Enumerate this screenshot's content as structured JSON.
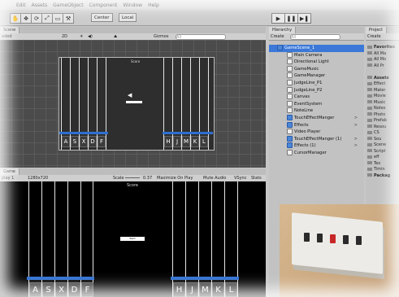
{
  "menu": [
    "Edit",
    "Assets",
    "GameObject",
    "Component",
    "Window",
    "Help"
  ],
  "toolbar": {
    "tools": [
      "✋",
      "✥",
      "⟳",
      "⤢",
      "▭",
      "⚒"
    ],
    "pivot_label": "Center",
    "local_label": "Local",
    "play": [
      "▶",
      "❚❚",
      "▶❚"
    ]
  },
  "scene": {
    "tab": "Scene",
    "shading": "aded",
    "twod": "2D",
    "gizmos": "Gizmos",
    "search_placeholder": "All",
    "overlay_score": "Score",
    "left_keys": [
      "A",
      "S",
      "X",
      "D",
      "F"
    ],
    "right_keys": [
      "H",
      "J",
      "M",
      "K",
      "L"
    ]
  },
  "game": {
    "tab": "Game",
    "display": "play 1",
    "resolution": "1280x720",
    "scale_label": "Scale",
    "scale_value": "0.37",
    "maximize": "Maximize On Play",
    "mute": "Mute Audio",
    "vsync": "VSync",
    "stats": "Stats",
    "score": "Score",
    "center_box": "Start",
    "left_keys": [
      "A",
      "S",
      "X",
      "D",
      "F"
    ],
    "right_keys": [
      "H",
      "J",
      "M",
      "K",
      "L"
    ]
  },
  "hierarchy": {
    "tab": "Hierarchy",
    "create": "Create",
    "search_placeholder": "All",
    "items": [
      {
        "label": "GameScene_1",
        "sel": true,
        "indent": 0,
        "icon": "blue",
        "arrow": ""
      },
      {
        "label": "Main Camera",
        "indent": 1,
        "icon": "",
        "arrow": ""
      },
      {
        "label": "Directional Light",
        "indent": 1,
        "icon": "",
        "arrow": ""
      },
      {
        "label": "GameMusic",
        "indent": 1,
        "icon": "",
        "arrow": ""
      },
      {
        "label": "GameManager",
        "indent": 1,
        "icon": "",
        "arrow": ""
      },
      {
        "label": "JudgeLine_P1",
        "indent": 1,
        "icon": "",
        "arrow": ""
      },
      {
        "label": "JudgeLine_P2",
        "indent": 1,
        "icon": "",
        "arrow": ""
      },
      {
        "label": "Canvas",
        "indent": 1,
        "icon": "",
        "arrow": ""
      },
      {
        "label": "EventSystem",
        "indent": 1,
        "icon": "",
        "arrow": ""
      },
      {
        "label": "NoteLine",
        "indent": 1,
        "icon": "",
        "arrow": ""
      },
      {
        "label": "TouchEffectManger",
        "indent": 1,
        "icon": "blue",
        "arrow": ">"
      },
      {
        "label": "Effects",
        "indent": 1,
        "icon": "blue",
        "arrow": ">"
      },
      {
        "label": "Video Player",
        "indent": 1,
        "icon": "",
        "arrow": ""
      },
      {
        "label": "TouchEffectManger (1)",
        "indent": 1,
        "icon": "blue",
        "arrow": ">"
      },
      {
        "label": "Effects (1)",
        "indent": 1,
        "icon": "blue",
        "arrow": ">"
      },
      {
        "label": "CursorManager",
        "indent": 1,
        "icon": "",
        "arrow": ""
      }
    ]
  },
  "project": {
    "tab": "Project",
    "create": "Create",
    "items": [
      {
        "label": "Favorites",
        "bold": true
      },
      {
        "label": "All Ma"
      },
      {
        "label": "All Mo"
      },
      {
        "label": "All Pr"
      },
      {
        "label": ""
      },
      {
        "label": "Assets",
        "bold": true
      },
      {
        "label": "Effect"
      },
      {
        "label": "Mater"
      },
      {
        "label": "Movie"
      },
      {
        "label": "Music"
      },
      {
        "label": "Notes"
      },
      {
        "label": "Photo"
      },
      {
        "label": "Prefab"
      },
      {
        "label": "Resou"
      },
      {
        "label": "CS"
      },
      {
        "label": "Sou"
      },
      {
        "label": "Scene"
      },
      {
        "label": "Script"
      },
      {
        "label": "eff"
      },
      {
        "label": "Tex"
      },
      {
        "label": "Timin"
      },
      {
        "label": "Packag",
        "bold": true
      }
    ]
  },
  "colors": {
    "judge_line": "#2e6fd1",
    "selection": "#3b78d8",
    "hardware_key_red": "#c62828"
  }
}
